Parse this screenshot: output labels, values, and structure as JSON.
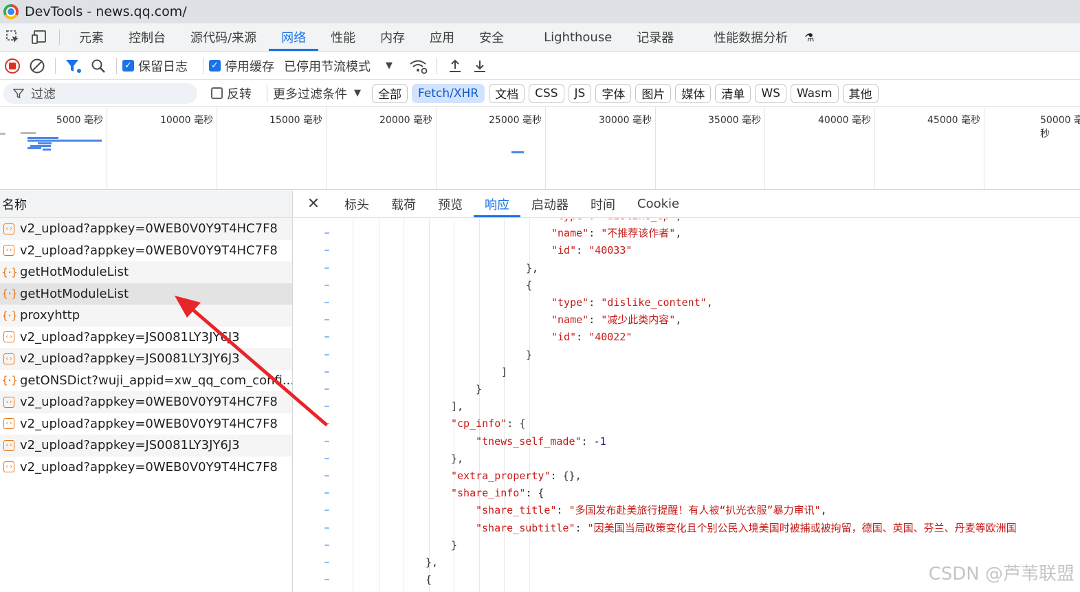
{
  "window": {
    "title": "DevTools - news.qq.com/"
  },
  "main_tabs": [
    "元素",
    "控制台",
    "源代码/来源",
    "网络",
    "性能",
    "内存",
    "应用",
    "安全",
    "Lighthouse",
    "记录器",
    "性能数据分析"
  ],
  "main_tabs_active": "网络",
  "toolbar": {
    "preserve_log": "保留日志",
    "disable_cache": "停用缓存",
    "throttle": "已停用节流模式"
  },
  "filter": {
    "placeholder": "过滤",
    "invert": "反转",
    "more_filters": "更多过滤条件",
    "types": [
      "全部",
      "Fetch/XHR",
      "文档",
      "CSS",
      "JS",
      "字体",
      "图片",
      "媒体",
      "清单",
      "WS",
      "Wasm",
      "其他"
    ],
    "active_type": "Fetch/XHR"
  },
  "overview": {
    "ticks": [
      "5000 毫秒",
      "10000 毫秒",
      "15000 毫秒",
      "20000 毫秒",
      "25000 毫秒",
      "30000 毫秒",
      "35000 毫秒",
      "40000 毫秒",
      "45000 毫秒",
      "50000 毫秒"
    ]
  },
  "request_list": {
    "header": "名称",
    "rows": [
      {
        "name": "v2_upload?appkey=0WEB0V0Y9T4HC7F8",
        "icon": "xhr-box-icon"
      },
      {
        "name": "v2_upload?appkey=0WEB0V0Y9T4HC7F8",
        "icon": "xhr-box-icon"
      },
      {
        "name": "getHotModuleList",
        "icon": "json-brace-icon"
      },
      {
        "name": "getHotModuleList",
        "icon": "json-brace-icon"
      },
      {
        "name": "proxyhttp",
        "icon": "json-brace-icon"
      },
      {
        "name": "v2_upload?appkey=JS0081LY3JY6J3",
        "icon": "xhr-box-icon"
      },
      {
        "name": "v2_upload?appkey=JS0081LY3JY6J3",
        "icon": "xhr-box-icon"
      },
      {
        "name": "getONSDict?wuji_appid=xw_qq_com_confi...",
        "icon": "json-brace-icon"
      },
      {
        "name": "v2_upload?appkey=0WEB0V0Y9T4HC7F8",
        "icon": "xhr-box-icon"
      },
      {
        "name": "v2_upload?appkey=0WEB0V0Y9T4HC7F8",
        "icon": "xhr-box-icon"
      },
      {
        "name": "v2_upload?appkey=JS0081LY3JY6J3",
        "icon": "xhr-box-icon"
      },
      {
        "name": "v2_upload?appkey=0WEB0V0Y9T4HC7F8",
        "icon": "xhr-box-icon"
      }
    ],
    "selected_index": 3
  },
  "detail_tabs": [
    "标头",
    "载荷",
    "预览",
    "响应",
    "启动器",
    "时间",
    "Cookie"
  ],
  "detail_active": "响应",
  "response_lines": [
    {
      "indent": 8,
      "html": "<span class='k'>\"type\"</span><span class='p'>: </span><span class='s'>\"dislike_cp\"</span><span class='p'>,</span>"
    },
    {
      "indent": 8,
      "html": "<span class='k'>\"name\"</span><span class='p'>: </span><span class='s'>\"不推荐该作者\"</span><span class='p'>,</span>"
    },
    {
      "indent": 8,
      "html": "<span class='k'>\"id\"</span><span class='p'>: </span><span class='s'>\"40033\"</span>"
    },
    {
      "indent": 7,
      "html": "<span class='p'>},</span>"
    },
    {
      "indent": 7,
      "html": "<span class='p'>{</span>"
    },
    {
      "indent": 8,
      "html": "<span class='k'>\"type\"</span><span class='p'>: </span><span class='s'>\"dislike_content\"</span><span class='p'>,</span>"
    },
    {
      "indent": 8,
      "html": "<span class='k'>\"name\"</span><span class='p'>: </span><span class='s'>\"减少此类内容\"</span><span class='p'>,</span>"
    },
    {
      "indent": 8,
      "html": "<span class='k'>\"id\"</span><span class='p'>: </span><span class='s'>\"40022\"</span>"
    },
    {
      "indent": 7,
      "html": "<span class='p'>}</span>"
    },
    {
      "indent": 6,
      "html": "<span class='p'>]</span>"
    },
    {
      "indent": 5,
      "html": "<span class='p'>}</span>"
    },
    {
      "indent": 4,
      "html": "<span class='p'>],</span>"
    },
    {
      "indent": 4,
      "html": "<span class='k'>\"cp_info\"</span><span class='p'>: {</span>"
    },
    {
      "indent": 5,
      "html": "<span class='k'>\"tnews_self_made\"</span><span class='p'>: </span><span class='n'>-1</span>"
    },
    {
      "indent": 4,
      "html": "<span class='p'>},</span>"
    },
    {
      "indent": 4,
      "html": "<span class='k'>\"extra_property\"</span><span class='p'>: {},</span>"
    },
    {
      "indent": 4,
      "html": "<span class='k'>\"share_info\"</span><span class='p'>: {</span>"
    },
    {
      "indent": 5,
      "html": "<span class='k'>\"share_title\"</span><span class='p'>: </span><span class='s'>\"多国发布赴美旅行提醒！有人被“扒光衣服”暴力审讯\"</span><span class='p'>,</span>"
    },
    {
      "indent": 5,
      "html": "<span class='k'>\"share_subtitle\"</span><span class='p'>: </span><span class='s'>\"因美国当局政策变化且个别公民入境美国时被捕或被拘留，德国、英国、芬兰、丹麦等欧洲国</span>"
    },
    {
      "indent": 4,
      "html": "<span class='p'>}</span>"
    },
    {
      "indent": 3,
      "html": "<span class='p'>},</span>"
    },
    {
      "indent": 3,
      "html": "<span class='p'>{</span>"
    }
  ],
  "watermark": "CSDN @芦苇联盟",
  "colors": {
    "accent": "#1a73e8",
    "annotation_arrow": "#e8252a",
    "icon_orange": "#e8710a"
  }
}
